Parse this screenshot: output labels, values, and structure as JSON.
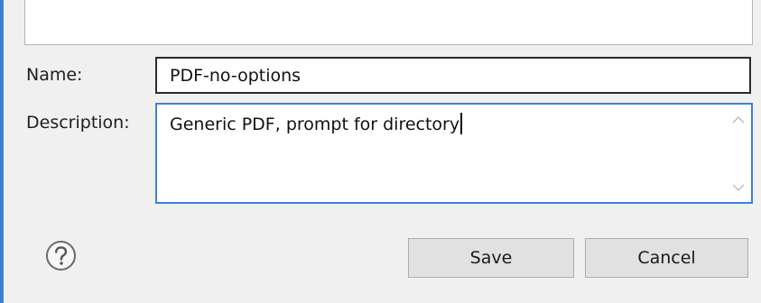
{
  "form": {
    "name_label": "Name:",
    "name_value": "PDF-no-options",
    "description_label": "Description:",
    "description_value": "Generic PDF, prompt for directory"
  },
  "buttons": {
    "save": "Save",
    "cancel": "Cancel"
  },
  "icons": {
    "help": "help-icon",
    "scroll_up": "chevron-up-icon",
    "scroll_down": "chevron-down-icon"
  },
  "colors": {
    "focus_border": "#3c82d6",
    "window_background": "#f0f0f0",
    "button_background": "#e1e1e1"
  }
}
